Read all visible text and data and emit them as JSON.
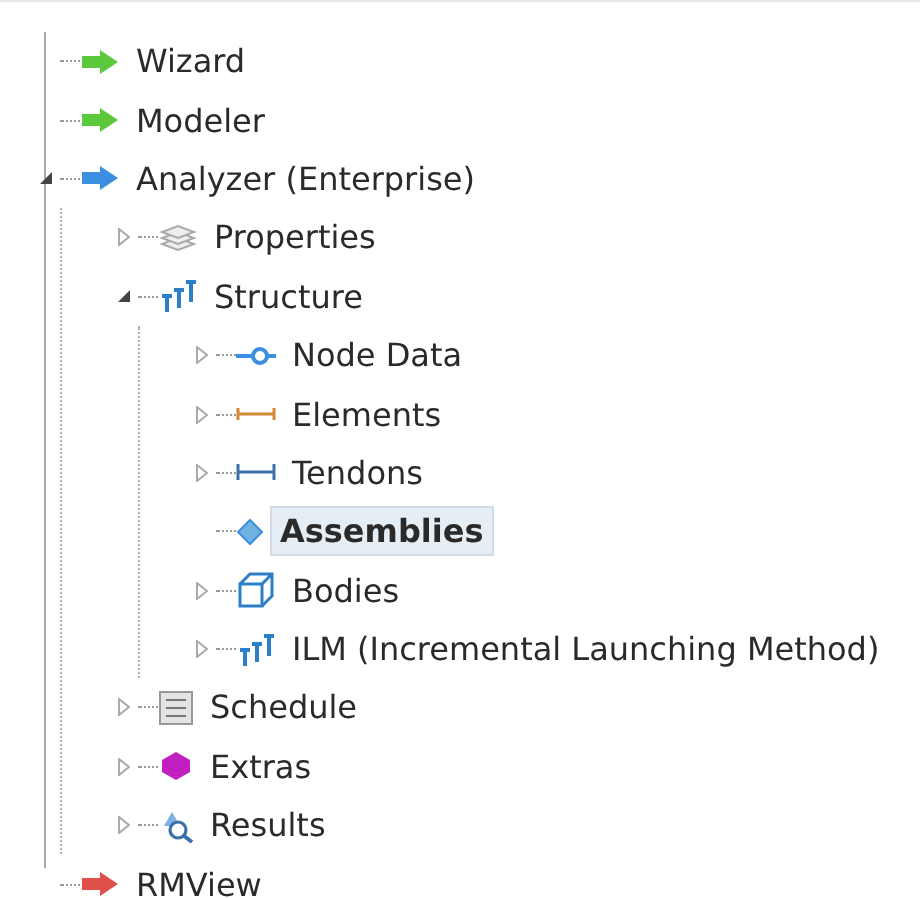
{
  "tree": [
    {
      "label": "Wizard",
      "kind": "arrow",
      "color": "#5cc83c",
      "selected": false
    },
    {
      "label": "Modeler",
      "kind": "arrow",
      "color": "#5cc83c",
      "selected": false
    },
    {
      "label": "Analyzer (Enterprise)",
      "kind": "arrow",
      "color": "#3c8fe0",
      "expanded": true,
      "selected": false,
      "children": [
        {
          "label": "Properties",
          "kind": "layers",
          "expanded": false,
          "selected": false
        },
        {
          "label": "Structure",
          "kind": "structure",
          "expanded": true,
          "selected": false,
          "children": [
            {
              "label": "Node Data",
              "kind": "node",
              "expanded": false,
              "selected": false
            },
            {
              "label": "Elements",
              "kind": "element",
              "expanded": false,
              "selected": false
            },
            {
              "label": "Tendons",
              "kind": "tendon",
              "expanded": false,
              "selected": false
            },
            {
              "label": "Assemblies",
              "kind": "diamond",
              "selected": true
            },
            {
              "label": "Bodies",
              "kind": "cube",
              "expanded": false,
              "selected": false
            },
            {
              "label": "ILM (Incremental Launching Method)",
              "kind": "structure",
              "expanded": false,
              "selected": false
            }
          ]
        },
        {
          "label": "Schedule",
          "kind": "schedule",
          "expanded": false,
          "selected": false
        },
        {
          "label": "Extras",
          "kind": "gem",
          "expanded": false,
          "selected": false
        },
        {
          "label": "Results",
          "kind": "results",
          "expanded": false,
          "selected": false
        }
      ]
    },
    {
      "label": "RMView",
      "kind": "arrow",
      "color": "#e0504a",
      "selected": false
    }
  ]
}
